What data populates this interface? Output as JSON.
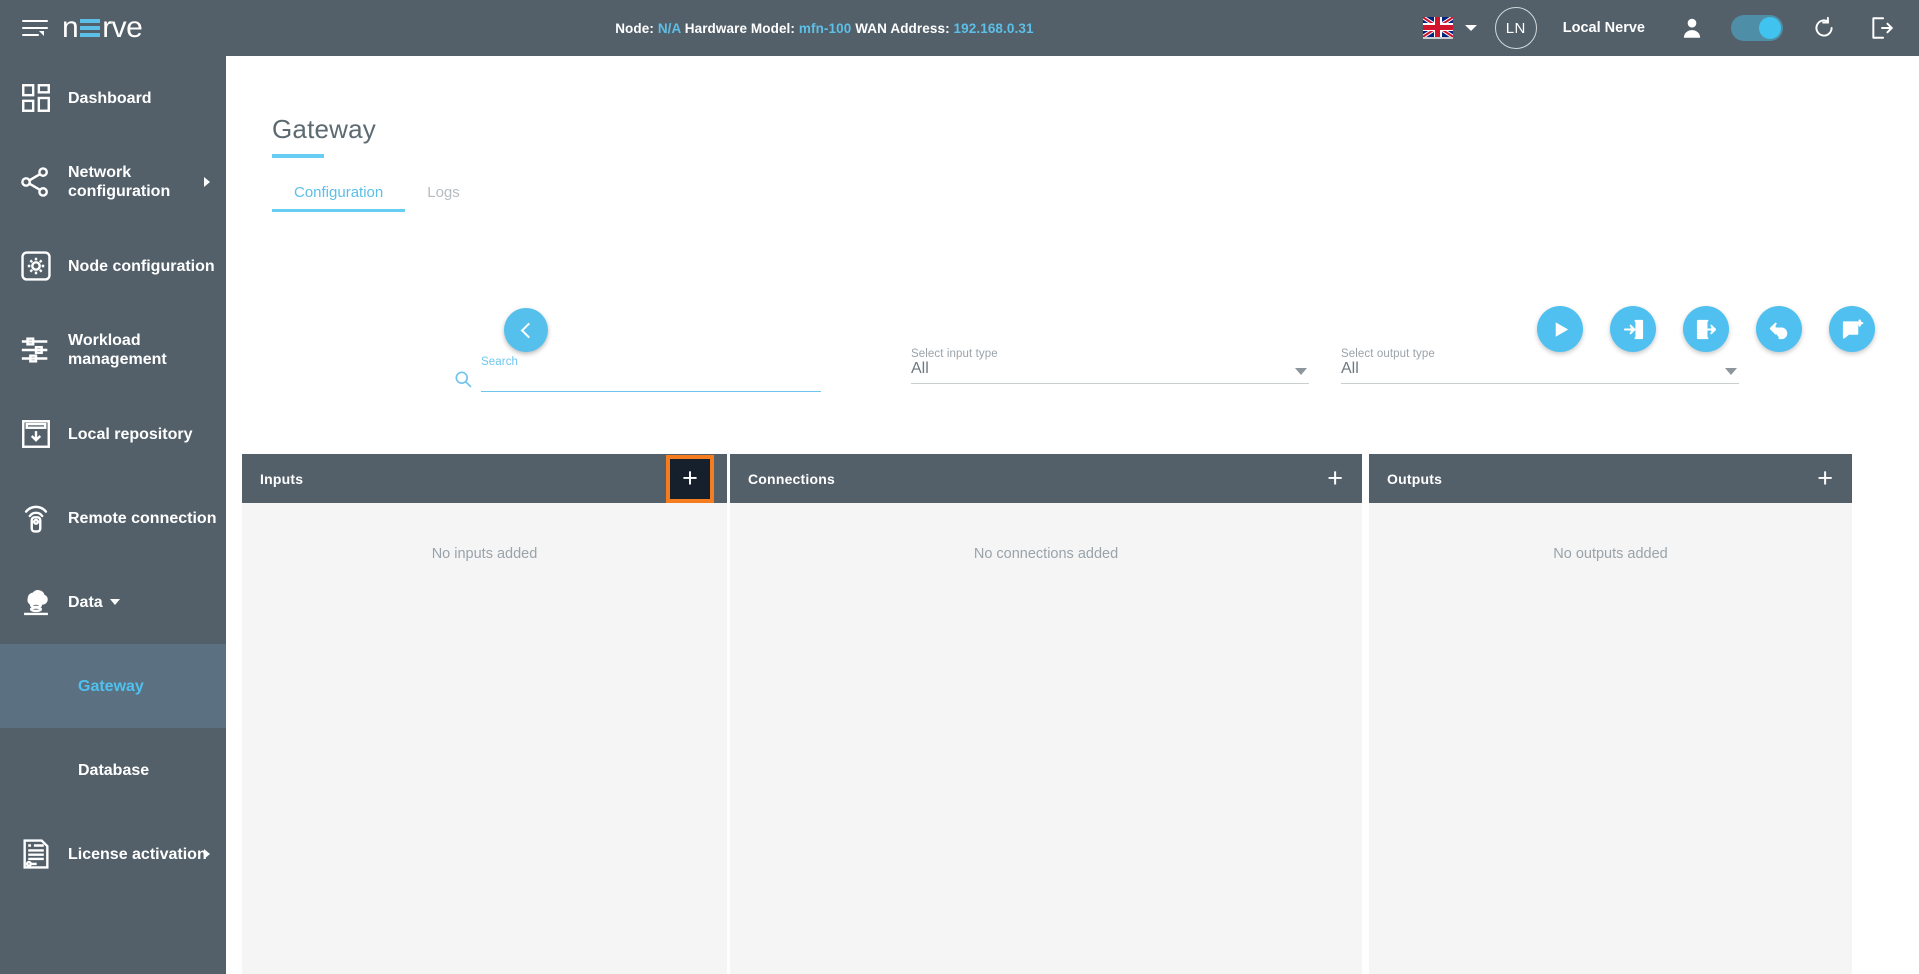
{
  "header": {
    "brand": {
      "prefix": "n",
      "accent_letter": "E",
      "suffix": "rve"
    },
    "menu_icon": "hamburger-icon",
    "status": {
      "node_label": "Node:",
      "node_value": "N/A",
      "hardware_label": "Hardware Model:",
      "hardware_value": "mfn-100",
      "wan_label": "WAN Address:",
      "wan_value": "192.168.0.31"
    },
    "language": {
      "flag": "uk-flag",
      "caret": "chevron-down-icon"
    },
    "avatar_initials": "LN",
    "username": "Local Nerve",
    "icons": [
      "user-icon",
      "toggle-switch",
      "restart-icon",
      "logout-icon"
    ],
    "toggle_on": true
  },
  "sidebar": {
    "items": [
      {
        "label": "Dashboard",
        "icon": "dashboard-icon",
        "expandable": false,
        "active": false,
        "sub": false
      },
      {
        "label": "Network configuration",
        "icon": "network-icon",
        "expandable": true,
        "active": false,
        "sub": false
      },
      {
        "label": "Node configuration",
        "icon": "node-gear-icon",
        "expandable": false,
        "active": false,
        "sub": false
      },
      {
        "label": "Workload management",
        "icon": "sliders-icon",
        "expandable": false,
        "active": false,
        "sub": false
      },
      {
        "label": "Local repository",
        "icon": "repository-icon",
        "expandable": false,
        "active": false,
        "sub": false
      },
      {
        "label": "Remote connection",
        "icon": "remote-icon",
        "expandable": false,
        "active": false,
        "sub": false
      },
      {
        "label": "Data",
        "icon": "data-cloud-icon",
        "expandable": false,
        "caret": true,
        "active": false,
        "sub": false
      },
      {
        "label": "Gateway",
        "icon": "",
        "expandable": false,
        "active": true,
        "sub": true
      },
      {
        "label": "Database",
        "icon": "",
        "expandable": false,
        "active": false,
        "sub": true
      },
      {
        "label": "License activation",
        "icon": "license-icon",
        "expandable": true,
        "active": false,
        "sub": false
      }
    ]
  },
  "main": {
    "page_title": "Gateway",
    "tabs": [
      {
        "label": "Configuration",
        "active": true
      },
      {
        "label": "Logs",
        "active": false
      }
    ],
    "back_button": "back-chevron-icon",
    "filters": {
      "search": {
        "label": "Search",
        "value": "",
        "icon": "search-icon"
      },
      "input_type": {
        "label": "Select input type",
        "value": "All"
      },
      "output_type": {
        "label": "Select output type",
        "value": "All"
      }
    },
    "actions": [
      {
        "name": "play-button",
        "icon": "play-icon"
      },
      {
        "name": "import-button",
        "icon": "import-icon"
      },
      {
        "name": "export-button",
        "icon": "export-icon"
      },
      {
        "name": "undo-button",
        "icon": "undo-icon"
      },
      {
        "name": "wizard-button",
        "icon": "form-wizard-icon"
      }
    ],
    "panels": [
      {
        "title": "Inputs",
        "empty_text": "No inputs added",
        "add_label": "+",
        "highlighted": true
      },
      {
        "title": "Connections",
        "empty_text": "No connections added",
        "add_label": "+",
        "highlighted": false
      },
      {
        "title": "Outputs",
        "empty_text": "No outputs added",
        "add_label": "+",
        "highlighted": false
      }
    ]
  },
  "colors": {
    "chrome": "#53606a",
    "accent": "#4fc0f0",
    "accent_light": "#68cdf2",
    "highlight": "#f57c1f",
    "panel_body": "#f5f5f5"
  }
}
